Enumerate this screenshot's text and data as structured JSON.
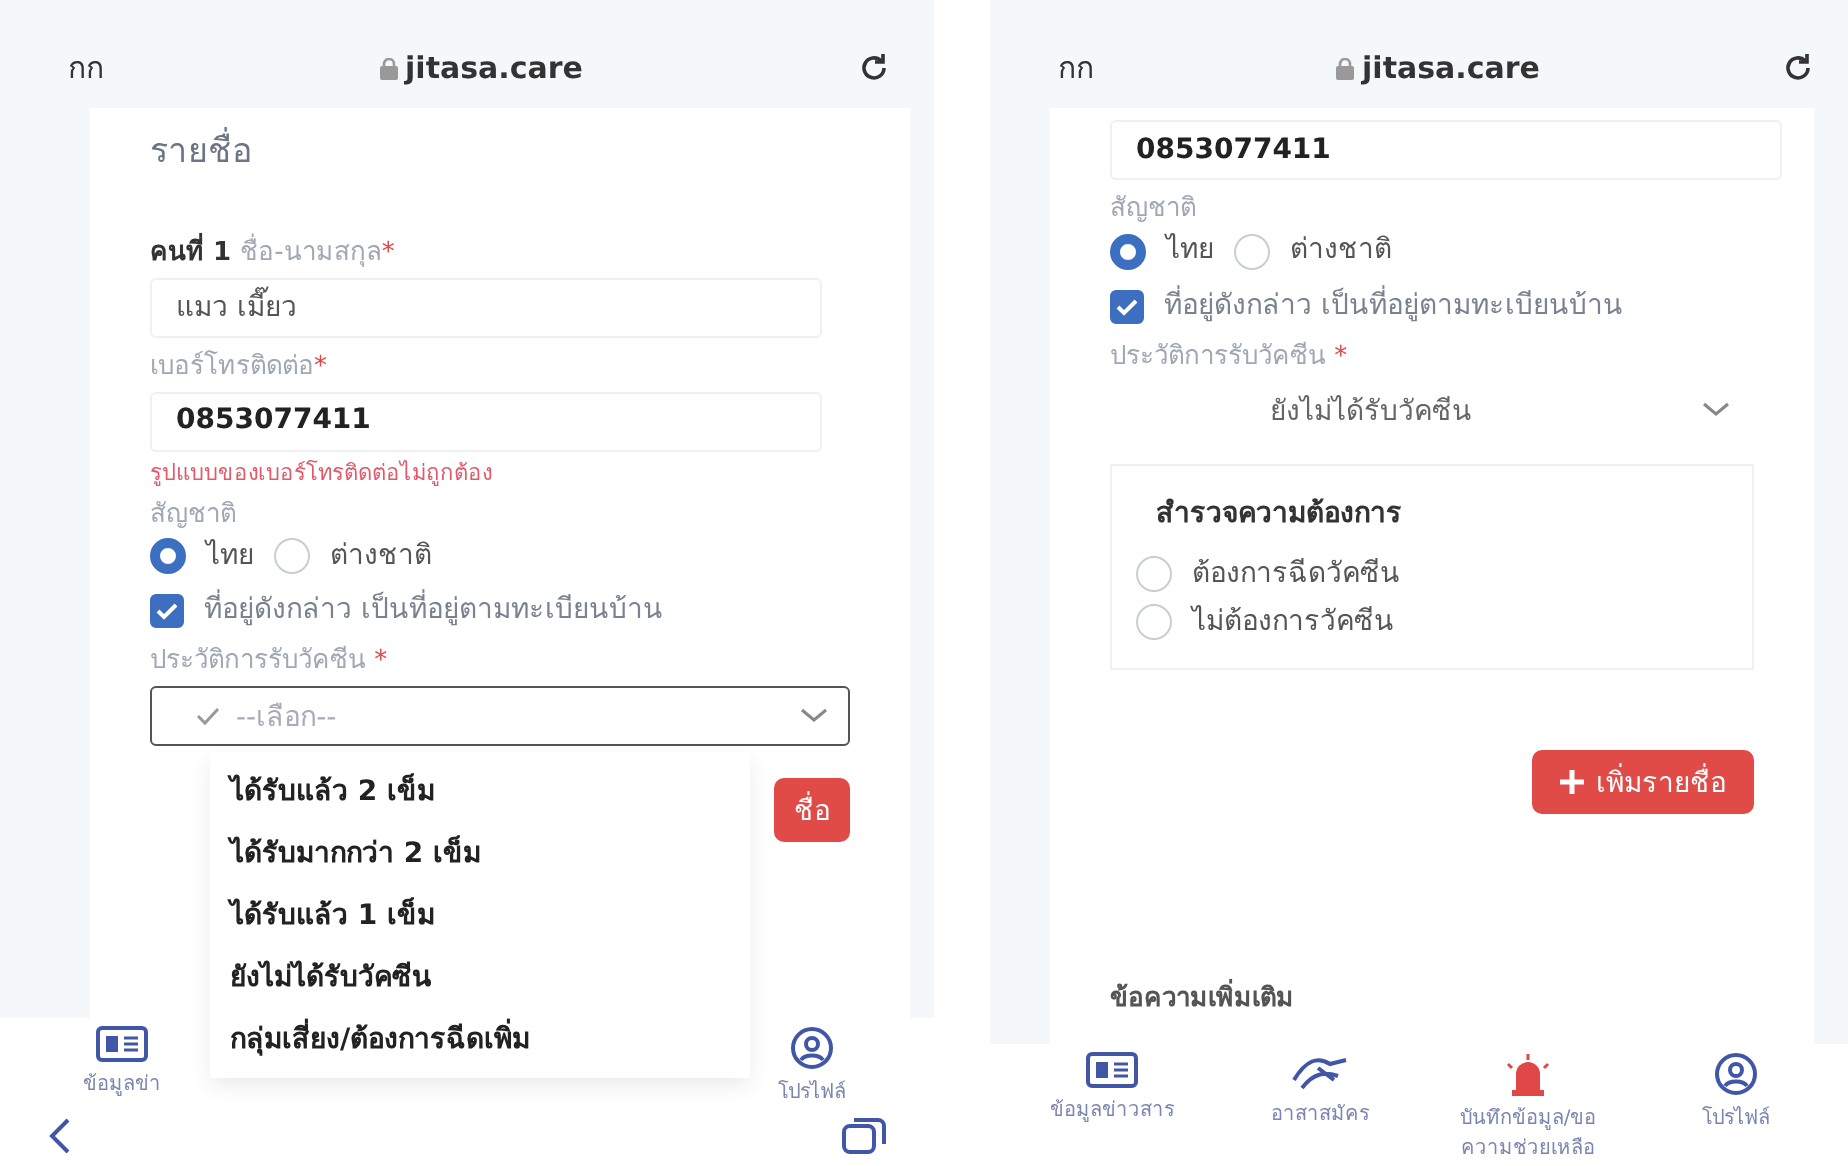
{
  "left_screen": {
    "browser": {
      "text_size_button": "กก",
      "url": "jitasa.care"
    },
    "card_title": "รายชื่อ",
    "fields": [
      {
        "prefix": "คนที่ 1",
        "label": "ชื่อ-นามสกุล",
        "required_mark": "*",
        "value": "แมว  เมี๊ยว"
      },
      {
        "label": "เบอร์โทรติดต่อ",
        "required_mark": "*",
        "value": "0853077411",
        "error": "รูปแบบของเบอร์โทรติดต่อไม่ถูกต้อง"
      }
    ],
    "nationality": {
      "label": "สัญชาติ",
      "options": [
        {
          "label": "ไทย",
          "selected": true
        },
        {
          "label": "ต่างชาติ",
          "selected": false
        }
      ]
    },
    "address_checkbox": {
      "label": "ที่อยู่ดังกล่าว เป็นที่อยู่ตามทะเบียนบ้าน",
      "checked": true
    },
    "vaccine": {
      "label": "ประวัติการรับวัคซีน",
      "required_mark": "*",
      "placeholder": "--เลือก--",
      "expanded": true,
      "options": [
        "ได้รับแล้ว 2 เข็ม",
        "ได้รับมากกว่า 2 เข็ม",
        "ได้รับแล้ว 1 เข็ม",
        "ยังไม่ได้รับวัคซีน",
        "กลุ่มเสี่ยง/ต้องการฉีดเพิ่ม"
      ]
    },
    "add_button": {
      "label": "ชื่อ"
    },
    "bottom_nav": [
      {
        "kind": "news",
        "label": "ข้อมูลข่า"
      },
      {
        "kind": "profile",
        "label": "โปรไฟล์"
      }
    ]
  },
  "right_screen": {
    "browser": {
      "text_size_button": "กก",
      "url": "jitasa.care"
    },
    "phone_value": "0853077411",
    "nationality": {
      "label": "สัญชาติ",
      "options": [
        {
          "label": "ไทย",
          "selected": true
        },
        {
          "label": "ต่างชาติ",
          "selected": false
        }
      ]
    },
    "address_checkbox": {
      "label": "ที่อยู่ดังกล่าว เป็นที่อยู่ตามทะเบียนบ้าน",
      "checked": true
    },
    "vaccine": {
      "label": "ประวัติการรับวัคซีน",
      "required_mark": "*",
      "value": "ยังไม่ได้รับวัคซีน",
      "expanded": false
    },
    "survey": {
      "title": "สำรวจความต้องการ",
      "options": [
        {
          "label": "ต้องการฉีดวัคซีน",
          "selected": false
        },
        {
          "label": "ไม่ต้องการวัคซีน",
          "selected": false
        }
      ]
    },
    "add_button": {
      "label": "เพิ่มรายชื่อ"
    },
    "extra_message_title": "ข้อความเพิ่มเติม",
    "bottom_nav": [
      {
        "kind": "news",
        "label": "ข้อมูลข่าวสาร"
      },
      {
        "kind": "volunteer",
        "label": "อาสาสมัคร"
      },
      {
        "kind": "alert",
        "label": "บันทึกข้อมูล/ขอความช่วยเหลือ"
      },
      {
        "kind": "profile",
        "label": "โปรไฟล์"
      }
    ]
  }
}
